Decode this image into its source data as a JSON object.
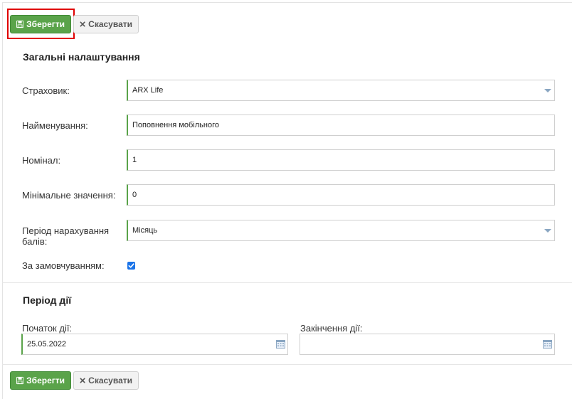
{
  "toolbar": {
    "save_label": "Зберегти",
    "cancel_label": "Скасувати"
  },
  "general": {
    "title": "Загальні налаштування",
    "insurer": {
      "label": "Страховик:",
      "value": "ARX Life"
    },
    "name": {
      "label": "Найменування:",
      "value": "Поповнення мобільного"
    },
    "nominal": {
      "label": "Номінал:",
      "value": "1"
    },
    "min_value": {
      "label": "Мінімальне значення:",
      "value": "0"
    },
    "period": {
      "label_line1": "Період нарахування",
      "label_line2": "балів:",
      "value": "Місяць"
    },
    "default": {
      "label": "За замовчуванням:",
      "checked": true
    }
  },
  "validity": {
    "title": "Період дії",
    "start": {
      "label": "Початок дії:",
      "value": "25.05.2022"
    },
    "end": {
      "label": "Закінчення дії:",
      "value": ""
    }
  },
  "colors": {
    "save_bg": "#5aa34a",
    "highlight": "#e00000",
    "checkbox": "#1a73e8"
  }
}
